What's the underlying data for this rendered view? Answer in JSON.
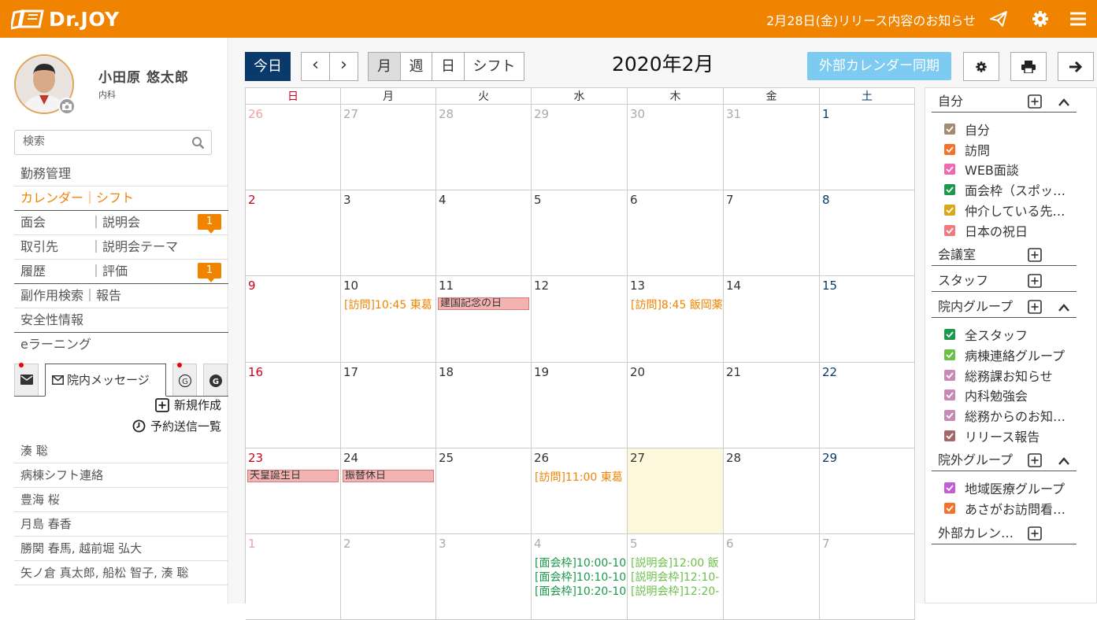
{
  "header": {
    "logo_text": "Dr.JOY",
    "release_notice": "2月28日(金)リリース内容のお知らせ",
    "brand_color": "#f08300"
  },
  "profile": {
    "name": "小田原 悠太郎",
    "department": "内科"
  },
  "search": {
    "placeholder": "検索"
  },
  "nav": [
    {
      "label": "勤務管理"
    },
    {
      "label": "カレンダー｜シフト",
      "active": true
    },
    {
      "label": "面会",
      "label2": "｜説明会",
      "badge": "1"
    },
    {
      "label": "取引先",
      "label2": "｜説明会テーマ"
    },
    {
      "label": "履歴",
      "label2": "｜評価",
      "badge": "1"
    },
    {
      "label": "副作用検索｜報告"
    },
    {
      "label": "安全性情報"
    },
    {
      "label": "eラーニング"
    }
  ],
  "message_tab": {
    "label": "院内メッセージ"
  },
  "actions": {
    "new": "新規作成",
    "scheduled": "予約送信一覧"
  },
  "messages": [
    "湊 聡",
    "病棟シフト連絡",
    "豊海 桜",
    "月島 春香",
    "勝関 春馬, 越前堀 弘大",
    "矢ノ倉 真太郎, 船松 智子, 湊 聡"
  ],
  "toolbar": {
    "today": "今日",
    "prev": "‹",
    "next": "›",
    "views": [
      "月",
      "週",
      "日",
      "シフト"
    ],
    "title": "2020年2月",
    "sync": "外部カレンダー同期"
  },
  "weekdays": [
    "日",
    "月",
    "火",
    "水",
    "木",
    "金",
    "土"
  ],
  "weeks": [
    [
      {
        "d": "26",
        "o": true
      },
      {
        "d": "27",
        "o": true
      },
      {
        "d": "28",
        "o": true
      },
      {
        "d": "29",
        "o": true
      },
      {
        "d": "30",
        "o": true
      },
      {
        "d": "31",
        "o": true
      },
      {
        "d": "1"
      }
    ],
    [
      {
        "d": "2"
      },
      {
        "d": "3"
      },
      {
        "d": "4"
      },
      {
        "d": "5"
      },
      {
        "d": "6"
      },
      {
        "d": "7"
      },
      {
        "d": "8"
      }
    ],
    [
      {
        "d": "9"
      },
      {
        "d": "10",
        "ev": [
          {
            "t": "[訪問]10:45 東葛",
            "c": "#f08300"
          }
        ]
      },
      {
        "d": "11",
        "hol": "建国記念の日"
      },
      {
        "d": "12"
      },
      {
        "d": "13",
        "ev": [
          {
            "t": "[訪問]8:45 飯岡薬",
            "c": "#f08300"
          }
        ]
      },
      {
        "d": "14"
      },
      {
        "d": "15"
      }
    ],
    [
      {
        "d": "16"
      },
      {
        "d": "17"
      },
      {
        "d": "18"
      },
      {
        "d": "19"
      },
      {
        "d": "20"
      },
      {
        "d": "21"
      },
      {
        "d": "22"
      }
    ],
    [
      {
        "d": "23",
        "hol": "天皇誕生日"
      },
      {
        "d": "24",
        "hol": "振替休日"
      },
      {
        "d": "25"
      },
      {
        "d": "26",
        "ev": [
          {
            "t": "[訪問]11:00 東葛",
            "c": "#f08300"
          }
        ]
      },
      {
        "d": "27",
        "today": true
      },
      {
        "d": "28"
      },
      {
        "d": "29"
      }
    ],
    [
      {
        "d": "1",
        "o": true
      },
      {
        "d": "2",
        "o": true
      },
      {
        "d": "3",
        "o": true
      },
      {
        "d": "4",
        "o": true,
        "ev": [
          {
            "t": "[面会枠]10:00-10",
            "c": "#1a9a4a"
          },
          {
            "t": "[面会枠]10:10-10",
            "c": "#1a9a4a"
          },
          {
            "t": "[面会枠]10:20-10",
            "c": "#1a9a4a"
          }
        ]
      },
      {
        "d": "5",
        "o": true,
        "ev": [
          {
            "t": "[説明会]12:00 飯",
            "c": "#6cc04a"
          },
          {
            "t": "[説明会枠]12:10-",
            "c": "#6cc04a"
          },
          {
            "t": "[説明会枠]12:20-",
            "c": "#6cc04a"
          }
        ]
      },
      {
        "d": "6",
        "o": true
      },
      {
        "d": "7",
        "o": true
      }
    ]
  ],
  "groups": [
    {
      "name": "自分",
      "collapse": true,
      "items": [
        {
          "label": "自分",
          "color": "#a58a72"
        },
        {
          "label": "訪問",
          "color": "#f4722b"
        },
        {
          "label": "WEB面談",
          "color": "#f069b0"
        },
        {
          "label": "面会枠（スポッ…",
          "color": "#1a9a4a"
        },
        {
          "label": "仲介している先…",
          "color": "#d9a81a"
        },
        {
          "label": "日本の祝日",
          "color": "#ee7b82"
        }
      ]
    },
    {
      "name": "会議室",
      "collapse": false,
      "items": []
    },
    {
      "name": "スタッフ",
      "collapse": false,
      "items": []
    },
    {
      "name": "院内グループ",
      "collapse": true,
      "items": [
        {
          "label": "全スタッフ",
          "color": "#1a9a4a"
        },
        {
          "label": "病棟連絡グループ",
          "color": "#6cc04a"
        },
        {
          "label": "総務課お知らせ",
          "color": "#c78ab8"
        },
        {
          "label": "内科勉強会",
          "color": "#c78ab8"
        },
        {
          "label": "総務からのお知…",
          "color": "#c78ab8"
        },
        {
          "label": "リリース報告",
          "color": "#a56868"
        }
      ]
    },
    {
      "name": "院外グループ",
      "collapse": true,
      "items": [
        {
          "label": "地域医療グループ",
          "color": "#c45bd8"
        },
        {
          "label": "あさがお訪問看…",
          "color": "#f4722b"
        }
      ]
    },
    {
      "name": "外部カレン…",
      "collapse": false,
      "items": []
    }
  ]
}
